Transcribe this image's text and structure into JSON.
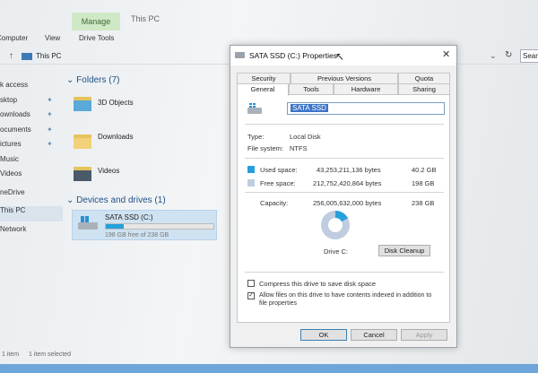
{
  "explorer": {
    "manage_tab": "Manage",
    "window_title": "This PC",
    "ribbon_tabs": [
      "Computer",
      "View",
      "Drive Tools"
    ],
    "breadcrumb": "This PC",
    "search_placeholder": "Sear",
    "nav_items": [
      "k access",
      "sktop",
      "ownloads",
      "ocuments",
      "ictures",
      "Music",
      "Videos",
      "neDrive",
      "This PC",
      "Network"
    ],
    "folders_header": "Folders (7)",
    "folders": [
      "3D Objects",
      "Downloads",
      "Videos"
    ],
    "devices_header": "Devices and drives (1)",
    "drive": {
      "name": "SATA SSD (C:)",
      "free_text": "198 GB free of 238 GB",
      "used_fraction": 0.168
    },
    "status_items": "1 item",
    "status_selected": "1 item selected"
  },
  "dialog": {
    "title": "SATA SSD (C:) Properties",
    "tabs_row1": [
      "Security",
      "Previous Versions",
      "Quota"
    ],
    "tabs_row2": [
      "General",
      "Tools",
      "Hardware",
      "Sharing"
    ],
    "name_value": "SATA SSD",
    "type_label": "Type:",
    "type_value": "Local Disk",
    "fs_label": "File system:",
    "fs_value": "NTFS",
    "used_label": "Used space:",
    "used_bytes": "43,253,211,136 bytes",
    "used_gb": "40.2 GB",
    "free_label": "Free space:",
    "free_bytes": "212,752,420,864 bytes",
    "free_gb": "198 GB",
    "capacity_label": "Capacity:",
    "capacity_bytes": "256,005,632,000 bytes",
    "capacity_gb": "238 GB",
    "drive_label": "Drive C:",
    "cleanup_button": "Disk Cleanup",
    "compress_label": "Compress this drive to save disk space",
    "index_label_1": "Allow files on this drive to have contents indexed in addition to",
    "index_label_2": "file properties",
    "ok_button": "OK",
    "cancel_button": "Cancel",
    "apply_button": "Apply",
    "used_fraction": 0.168,
    "used_color": "#26a0da",
    "free_color": "#bfcde0"
  }
}
